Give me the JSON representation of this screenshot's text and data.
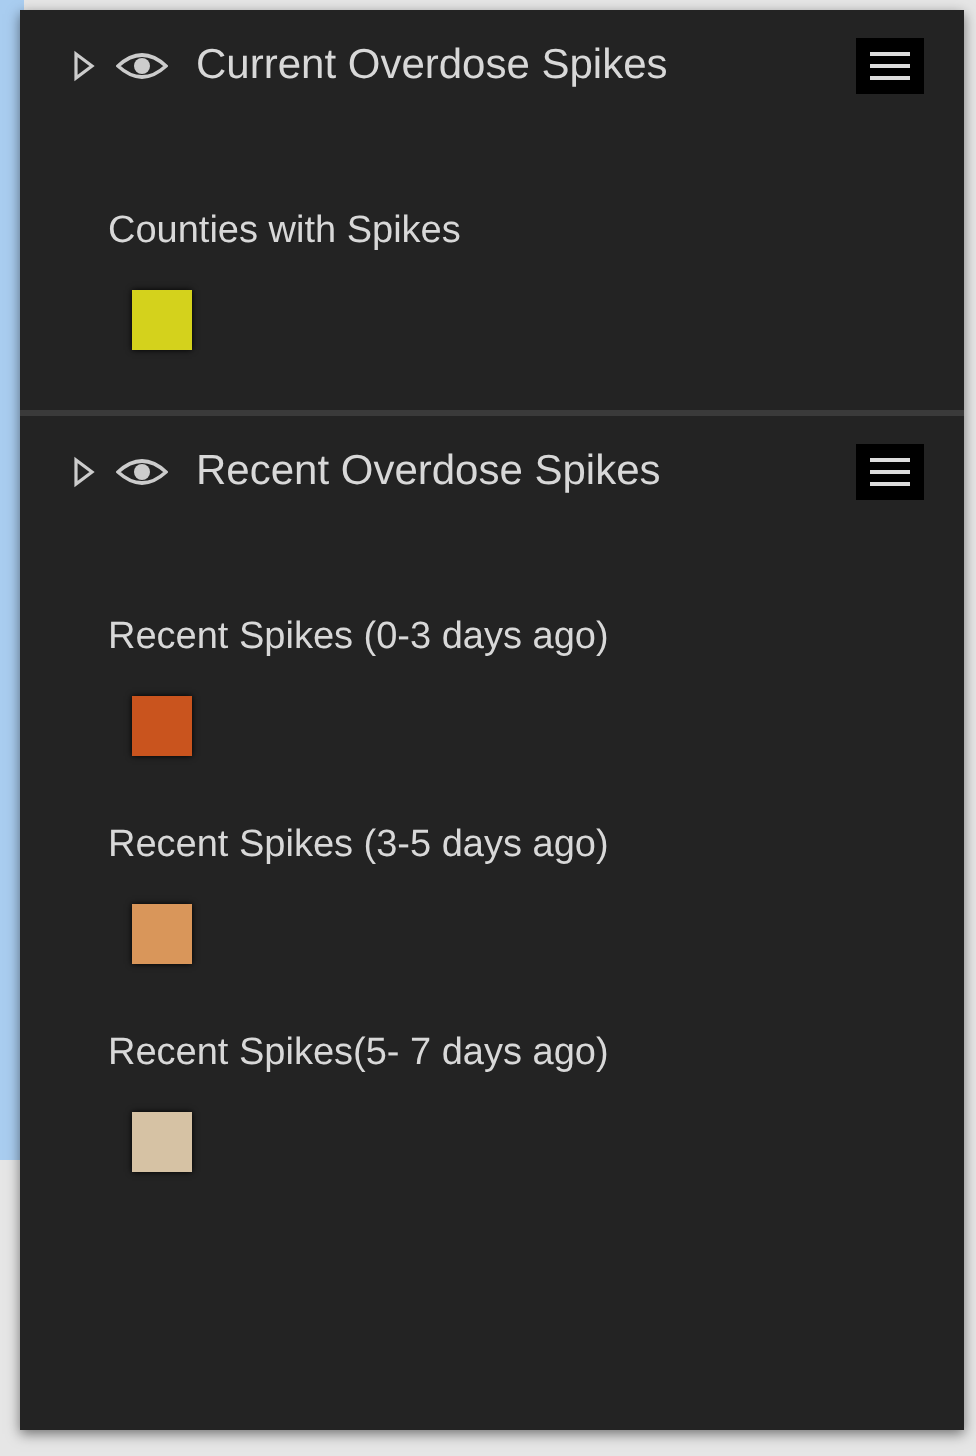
{
  "layers": [
    {
      "title": "Current Overdose Spikes",
      "entries": [
        {
          "label": "Counties with Spikes",
          "color": "#d4d21c"
        }
      ]
    },
    {
      "title": "Recent Overdose Spikes",
      "entries": [
        {
          "label": "Recent Spikes (0-3 days ago)",
          "color": "#c9541e"
        },
        {
          "label": "Recent Spikes (3-5 days ago)",
          "color": "#d9965a"
        },
        {
          "label": "Recent Spikes(5- 7 days ago)",
          "color": "#d6c2a4"
        }
      ]
    }
  ]
}
